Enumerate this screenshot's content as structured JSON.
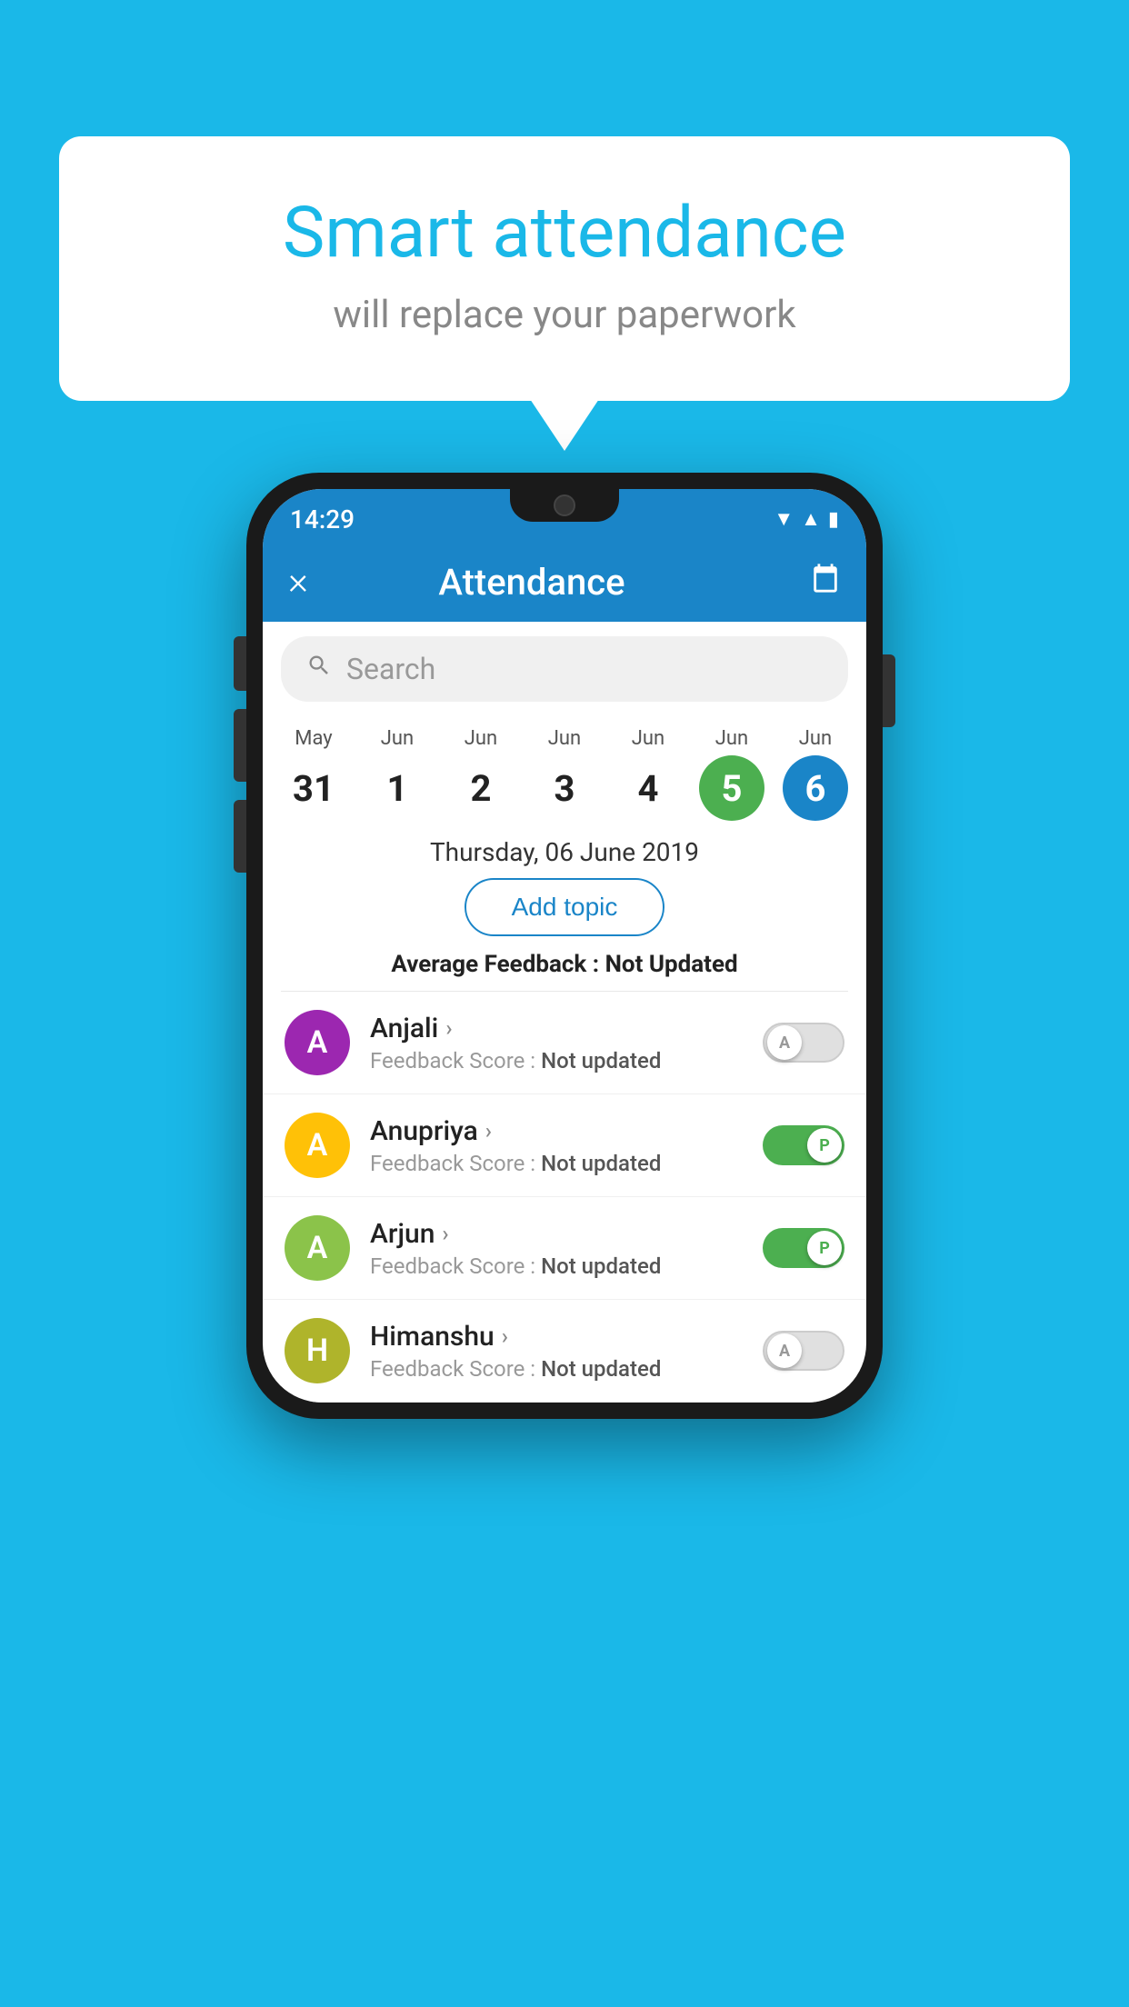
{
  "background_color": "#1ab8e8",
  "speech_bubble": {
    "title": "Smart attendance",
    "subtitle": "will replace your paperwork"
  },
  "status_bar": {
    "time": "14:29",
    "icons": [
      "wifi",
      "signal",
      "battery"
    ]
  },
  "app_bar": {
    "title": "Attendance",
    "close_label": "×",
    "calendar_icon": "📅"
  },
  "search": {
    "placeholder": "Search"
  },
  "dates": [
    {
      "month": "May",
      "day": "31",
      "selected": ""
    },
    {
      "month": "Jun",
      "day": "1",
      "selected": ""
    },
    {
      "month": "Jun",
      "day": "2",
      "selected": ""
    },
    {
      "month": "Jun",
      "day": "3",
      "selected": ""
    },
    {
      "month": "Jun",
      "day": "4",
      "selected": ""
    },
    {
      "month": "Jun",
      "day": "5",
      "selected": "green"
    },
    {
      "month": "Jun",
      "day": "6",
      "selected": "blue"
    }
  ],
  "selected_date_label": "Thursday, 06 June 2019",
  "add_topic_label": "Add topic",
  "average_feedback_prefix": "Average Feedback : ",
  "average_feedback_value": "Not Updated",
  "students": [
    {
      "name": "Anjali",
      "avatar_letter": "A",
      "avatar_color": "purple",
      "feedback_prefix": "Feedback Score : ",
      "feedback_value": "Not updated",
      "toggle_state": "off",
      "toggle_letter": "A"
    },
    {
      "name": "Anupriya",
      "avatar_letter": "A",
      "avatar_color": "yellow",
      "feedback_prefix": "Feedback Score : ",
      "feedback_value": "Not updated",
      "toggle_state": "on",
      "toggle_letter": "P"
    },
    {
      "name": "Arjun",
      "avatar_letter": "A",
      "avatar_color": "green",
      "feedback_prefix": "Feedback Score : ",
      "feedback_value": "Not updated",
      "toggle_state": "on",
      "toggle_letter": "P"
    },
    {
      "name": "Himanshu",
      "avatar_letter": "H",
      "avatar_color": "olive",
      "feedback_prefix": "Feedback Score : ",
      "feedback_value": "Not updated",
      "toggle_state": "off",
      "toggle_letter": "A"
    }
  ]
}
